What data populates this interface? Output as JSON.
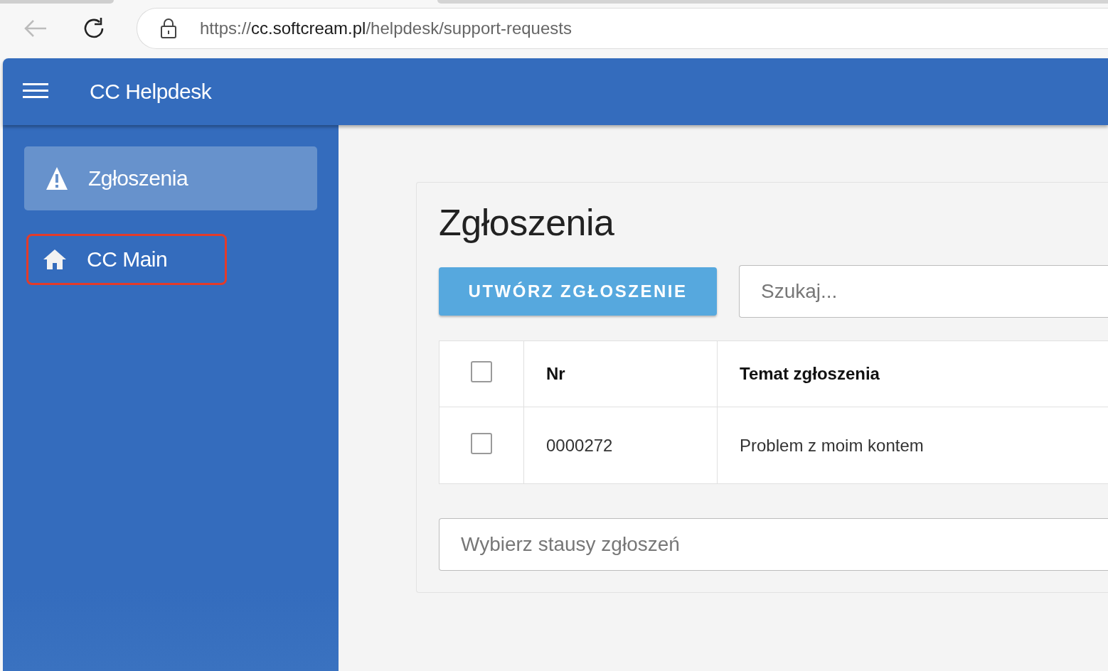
{
  "browser": {
    "url_scheme": "https://",
    "url_host": "cc.softcream.pl",
    "url_path": "/helpdesk/support-requests"
  },
  "app": {
    "title": "CC Helpdesk"
  },
  "sidebar": {
    "items": [
      {
        "label": "Zgłoszenia",
        "kind": "warning",
        "selected": true,
        "highlighted": false
      },
      {
        "label": "CC Main",
        "kind": "home",
        "selected": false,
        "highlighted": true
      }
    ]
  },
  "page": {
    "title": "Zgłoszenia",
    "create_button": "UTWÓRZ ZGŁOSZENIE",
    "search": {
      "placeholder": "Szukaj..."
    },
    "table": {
      "select_all": {
        "checked": false
      },
      "columns": [
        "Nr",
        "Temat zgłoszenia"
      ],
      "rows": [
        {
          "checked": false,
          "cells": [
            "0000272",
            "Problem z moim kontem"
          ]
        }
      ]
    },
    "status_filter": {
      "placeholder": "Wybierz stausy zgłoszeń"
    }
  }
}
